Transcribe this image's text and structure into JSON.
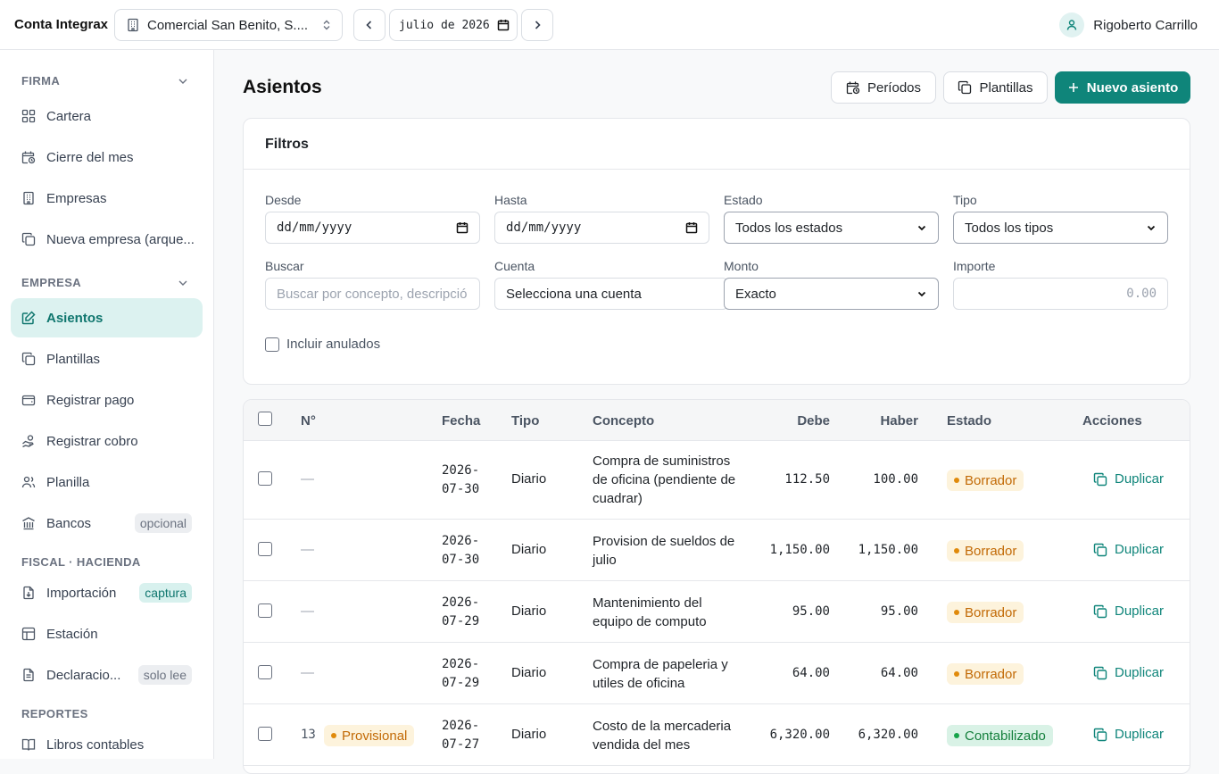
{
  "topbar": {
    "brand": "Conta Integrax",
    "company": "Comercial San Benito, S....",
    "month": "julio de 2026",
    "user_name": "Rigoberto Carrillo"
  },
  "sidebar": {
    "sections": [
      {
        "title": "FIRMA",
        "items": [
          {
            "label": "Cartera",
            "icon": "grid-icon"
          },
          {
            "label": "Cierre del mes",
            "icon": "calendar-clock-icon"
          },
          {
            "label": "Empresas",
            "icon": "building-icon"
          },
          {
            "label": "Nueva empresa (arque...",
            "icon": "copy-icon"
          }
        ]
      },
      {
        "title": "EMPRESA",
        "items": [
          {
            "label": "Asientos",
            "icon": "edit-icon",
            "active": true
          },
          {
            "label": "Plantillas",
            "icon": "copy-icon"
          },
          {
            "label": "Registrar pago",
            "icon": "wallet-icon"
          },
          {
            "label": "Registrar cobro",
            "icon": "hand-coins-icon"
          },
          {
            "label": "Planilla",
            "icon": "users-icon"
          },
          {
            "label": "Bancos",
            "icon": "bank-icon",
            "badge": "opcional"
          }
        ]
      },
      {
        "title": "FISCAL · HACIENDA",
        "items": [
          {
            "label": "Importación",
            "icon": "file-import-icon",
            "badge": "captura"
          },
          {
            "label": "Estación",
            "icon": "table-icon"
          },
          {
            "label": "Declaracio...",
            "icon": "document-icon",
            "badge": "solo lee"
          }
        ]
      },
      {
        "title": "REPORTES",
        "items": [
          {
            "label": "Libros contables",
            "icon": "book-icon"
          }
        ]
      }
    ]
  },
  "page": {
    "title": "Asientos",
    "btn_periodos": "Períodos",
    "btn_plantillas": "Plantillas",
    "btn_nuevo": "Nuevo asiento"
  },
  "filters": {
    "title": "Filtros",
    "desde_label": "Desde",
    "desde_value": "dd/mm/yyyy",
    "hasta_label": "Hasta",
    "hasta_value": "dd/mm/yyyy",
    "estado_label": "Estado",
    "estado_value": "Todos los estados",
    "tipo_label": "Tipo",
    "tipo_value": "Todos los tipos",
    "buscar_label": "Buscar",
    "buscar_placeholder": "Buscar por concepto, descripció",
    "cuenta_label": "Cuenta",
    "cuenta_value": "Selecciona una cuenta",
    "monto_label": "Monto",
    "monto_value": "Exacto",
    "importe_label": "Importe",
    "importe_placeholder": "0.00",
    "anulados_label": "Incluir anulados"
  },
  "table": {
    "headers": {
      "num": "N°",
      "fecha": "Fecha",
      "tipo": "Tipo",
      "concepto": "Concepto",
      "debe": "Debe",
      "haber": "Haber",
      "estado": "Estado",
      "acciones": "Acciones"
    },
    "rows": [
      {
        "num": "—",
        "fecha": [
          "2026-",
          "07-30"
        ],
        "tipo": "Diario",
        "concepto": [
          "Compra de suministros",
          "de oficina (pendiente de",
          "cuadrar)"
        ],
        "debe": "112.50",
        "haber": "100.00",
        "estado": "Borrador",
        "accion": "Duplicar"
      },
      {
        "num": "—",
        "fecha": [
          "2026-",
          "07-30"
        ],
        "tipo": "Diario",
        "concepto": [
          "Provision de sueldos de",
          "julio"
        ],
        "debe": "1,150.00",
        "haber": "1,150.00",
        "estado": "Borrador",
        "accion": "Duplicar"
      },
      {
        "num": "—",
        "fecha": [
          "2026-",
          "07-29"
        ],
        "tipo": "Diario",
        "concepto": [
          "Mantenimiento del",
          "equipo de computo"
        ],
        "debe": "95.00",
        "haber": "95.00",
        "estado": "Borrador",
        "accion": "Duplicar"
      },
      {
        "num": "—",
        "fecha": [
          "2026-",
          "07-29"
        ],
        "tipo": "Diario",
        "concepto": [
          "Compra de papeleria y",
          "utiles de oficina"
        ],
        "debe": "64.00",
        "haber": "64.00",
        "estado": "Borrador",
        "accion": "Duplicar"
      },
      {
        "num": "13",
        "num_badge": "Provisional",
        "fecha": [
          "2026-",
          "07-27"
        ],
        "tipo": "Diario",
        "concepto": [
          "Costo de la mercaderia",
          "vendida del mes"
        ],
        "debe": "6,320.00",
        "haber": "6,320.00",
        "estado": "Contabilizado",
        "accion": "Duplicar"
      }
    ]
  }
}
